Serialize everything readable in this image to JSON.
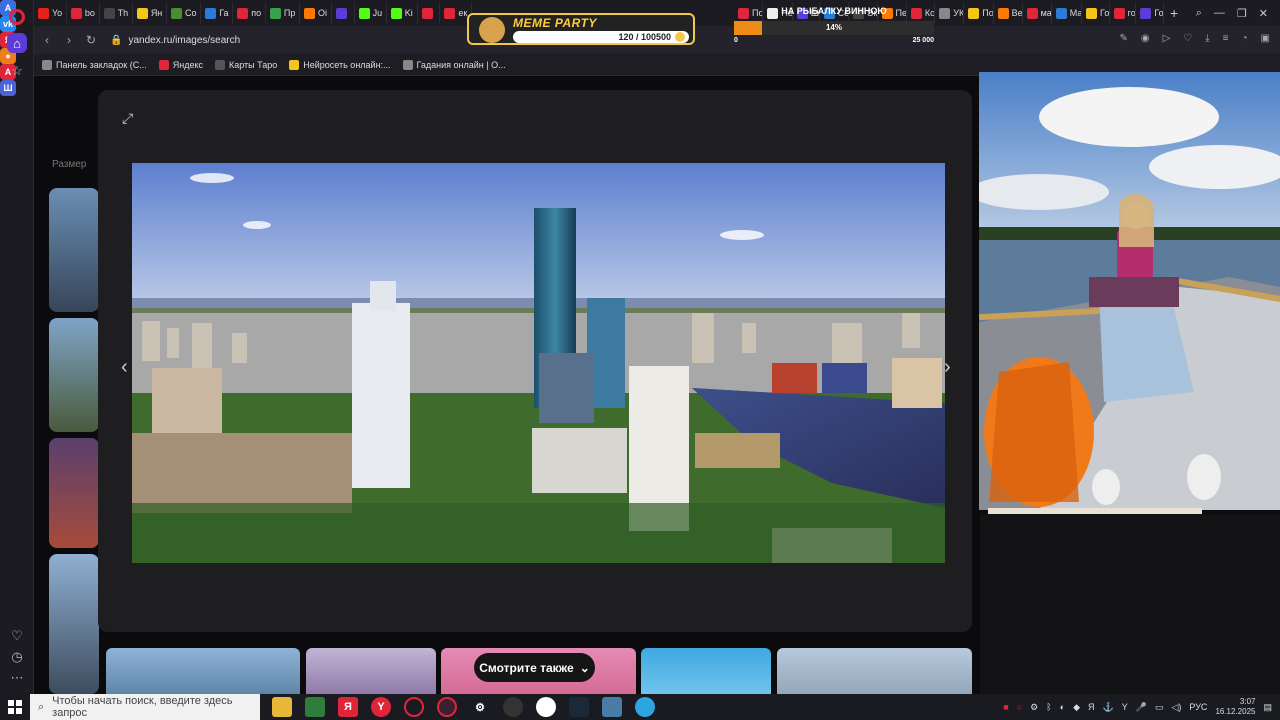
{
  "browser": {
    "tabs": [
      {
        "label": "Yo",
        "color": "#e62117"
      },
      {
        "label": "bo",
        "color": "#e0243a"
      },
      {
        "label": "Th",
        "color": "#444"
      },
      {
        "label": "Ян",
        "color": "#f5c518"
      },
      {
        "label": "Co",
        "color": "#4a8d2e"
      },
      {
        "label": "Га",
        "color": "#2b7bd6"
      },
      {
        "label": "по",
        "color": "#e0243a"
      },
      {
        "label": "Пр",
        "color": "#3aa14a"
      },
      {
        "label": "Oi",
        "color": "#ff7a00"
      },
      {
        "label": "",
        "color": "#5c3bd8"
      },
      {
        "label": "Ju",
        "color": "#53fc18"
      },
      {
        "label": "Ki",
        "color": "#53fc18"
      },
      {
        "label": "",
        "color": "#e0243a"
      },
      {
        "label": "ек",
        "color": "#e0243a"
      }
    ],
    "tabs_right": [
      {
        "label": "По",
        "color": "#e0243a"
      },
      {
        "label": "Не",
        "color": "#eee"
      },
      {
        "label": "Ш",
        "color": "#5c3bd8"
      },
      {
        "label": "Се",
        "color": "#2b7bd6"
      },
      {
        "label": "Эк",
        "color": "#444"
      },
      {
        "label": "Пе",
        "color": "#ff7a00"
      },
      {
        "label": "Ко",
        "color": "#e0243a"
      },
      {
        "label": "УК",
        "color": "#888"
      },
      {
        "label": "По",
        "color": "#f5c518"
      },
      {
        "label": "Ве",
        "color": "#ff7a00"
      },
      {
        "label": "ма",
        "color": "#e0243a"
      },
      {
        "label": "Ма",
        "color": "#2b7bd6"
      },
      {
        "label": "Го",
        "color": "#f5c518"
      },
      {
        "label": "го",
        "color": "#e0243a"
      },
      {
        "label": "Го",
        "color": "#5c3bd8"
      }
    ],
    "address": "yandex.ru/images/search",
    "bookmarks": [
      {
        "label": "Панель закладок (С...",
        "color": "#888"
      },
      {
        "label": "Яндекс",
        "color": "#e0243a"
      },
      {
        "label": "Карты Таро",
        "color": "#555"
      },
      {
        "label": "Нейросеть онлайн:...",
        "color": "#f5c518"
      },
      {
        "label": "Гадания онлайн | О...",
        "color": "#888"
      }
    ]
  },
  "overlay": {
    "meme_title": "MEME PARTY",
    "meme_count": "120 / 100500",
    "fish_title": "НА РЫБАЛКУ ВИННОЮ",
    "fish_percent": "14%",
    "fish_progress": 0.14,
    "fish_min": "0",
    "fish_max": "25 000"
  },
  "page": {
    "size_label": "Размер",
    "see_also": "Смотрите также"
  },
  "taskbar": {
    "search_placeholder": "Чтобы начать поиск, введите здесь запрос",
    "lang": "РУС",
    "time": "3:07",
    "date": "16.12.2025"
  }
}
